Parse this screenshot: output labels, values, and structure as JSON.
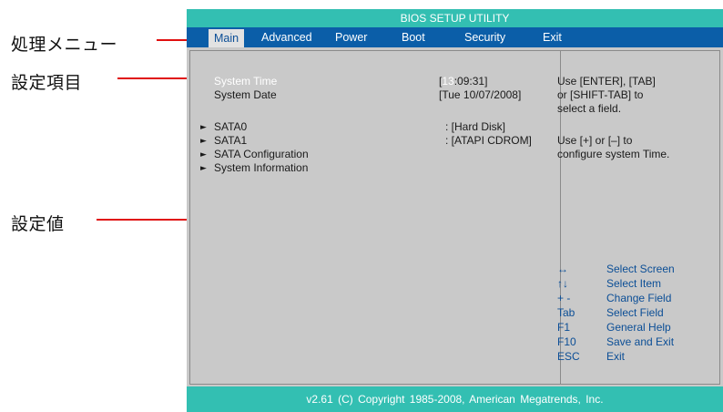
{
  "callouts": {
    "menu": "処理メニュー",
    "items": "設定項目",
    "values": "設定値"
  },
  "bios": {
    "title": "BIOS SETUP UTILITY",
    "menu": [
      "Main",
      "Advanced",
      "Power",
      "Boot",
      "Security",
      "Exit"
    ],
    "active_menu": "Main",
    "items": {
      "system_time": "System Time",
      "system_date": "System Date",
      "sata0": "SATA0",
      "sata1": "SATA1",
      "sata_config": "SATA Configuration",
      "system_info": "System Information"
    },
    "values": {
      "time_open": "[",
      "time_hour": "13",
      "time_rest": ":09:31]",
      "date": "[Tue 10/07/2008]",
      "sata0": ": [Hard Disk]",
      "sata1": ": [ATAPI CDROM]"
    },
    "help": {
      "line1": "Use [ENTER], [TAB]",
      "line2": "or [SHIFT-TAB] to",
      "line3": "select a field.",
      "line4": "Use [+] or [–] to",
      "line5": "configure system Time."
    },
    "keys": [
      {
        "key": "↔",
        "desc": "Select Screen"
      },
      {
        "key": "↑↓",
        "desc": "Select Item"
      },
      {
        "key": "+ -",
        "desc": "Change Field"
      },
      {
        "key": "Tab",
        "desc": "Select Field"
      },
      {
        "key": "F1",
        "desc": "General Help"
      },
      {
        "key": "F10",
        "desc": "Save and Exit"
      },
      {
        "key": "ESC",
        "desc": "Exit"
      }
    ],
    "footer": "v2.61 (C) Copyright 1985-2008, American Megatrends, Inc."
  },
  "colors": {
    "title_bar": "#33bfb2",
    "menu_bar": "#0b5ea8",
    "panel": "#c9c9c9",
    "callout_line": "#e01010",
    "key_text": "#0b4e96"
  },
  "icons": {
    "submenu": "submenu-triangle-icon"
  }
}
